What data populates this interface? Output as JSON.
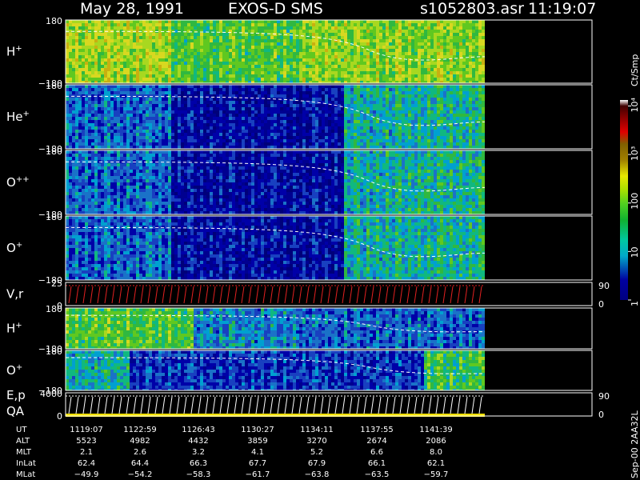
{
  "header": {
    "date": "May 28, 1991",
    "instrument": "EXOS-D SMS",
    "file": "s1052803.asr",
    "time": "11:19:07"
  },
  "chart_data": {
    "type": "heatmap",
    "panels": [
      {
        "label": "H",
        "sup": "+",
        "y_top": "180",
        "y_bottom": "−180",
        "ylim": [
          -180,
          180
        ]
      },
      {
        "label": "He",
        "sup": "+",
        "y_top": "180",
        "y_bottom": "−180",
        "ylim": [
          -180,
          180
        ]
      },
      {
        "label": "O",
        "sup": "++",
        "y_top": "180",
        "y_bottom": "−180",
        "ylim": [
          -180,
          180
        ]
      },
      {
        "label": "O",
        "sup": "+",
        "y_top": "180",
        "y_bottom": "−180",
        "ylim": [
          -180,
          180
        ]
      },
      {
        "label": "V,r",
        "sup": "",
        "y_top": "25",
        "y_bottom": "0",
        "right_top": "90",
        "right_bottom": "0"
      },
      {
        "label": "H",
        "sup": "+",
        "y_top": "180",
        "y_bottom": "−180",
        "ylim": [
          -180,
          180
        ]
      },
      {
        "label": "O",
        "sup": "+",
        "y_top": "180",
        "y_bottom": "−180",
        "ylim": [
          -180,
          180
        ]
      },
      {
        "label": "E,p",
        "label2": "QA",
        "sup": "",
        "y_top": "4000",
        "y_bottom": "0",
        "right_top": "90",
        "right_bottom": "0"
      }
    ],
    "colorbar": {
      "unit": "Ct/Smp",
      "scale": "log",
      "ticks": [
        "1",
        "10",
        "100",
        "10³",
        "10⁴"
      ]
    },
    "x": {
      "rows": [
        {
          "name": "UT",
          "values": [
            "1119:07",
            "1122:59",
            "1126:43",
            "1130:27",
            "1134:11",
            "1137:55",
            "1141:39"
          ]
        },
        {
          "name": "ALT",
          "values": [
            "5523",
            "4982",
            "4432",
            "3859",
            "3270",
            "2674",
            "2086"
          ]
        },
        {
          "name": "MLT",
          "values": [
            "2.1",
            "2.6",
            "3.2",
            "4.1",
            "5.2",
            "6.6",
            "8.0"
          ]
        },
        {
          "name": "InLat",
          "values": [
            "62.4",
            "64.4",
            "66.3",
            "67.7",
            "67.9",
            "66.1",
            "62.1"
          ]
        },
        {
          "name": "MLat",
          "values": [
            "−49.9",
            "−54.2",
            "−58.3",
            "−61.7",
            "−63.8",
            "−63.5",
            "−59.7"
          ]
        }
      ]
    }
  },
  "footer": {
    "stamp": "Sep-00  2AA32L"
  }
}
